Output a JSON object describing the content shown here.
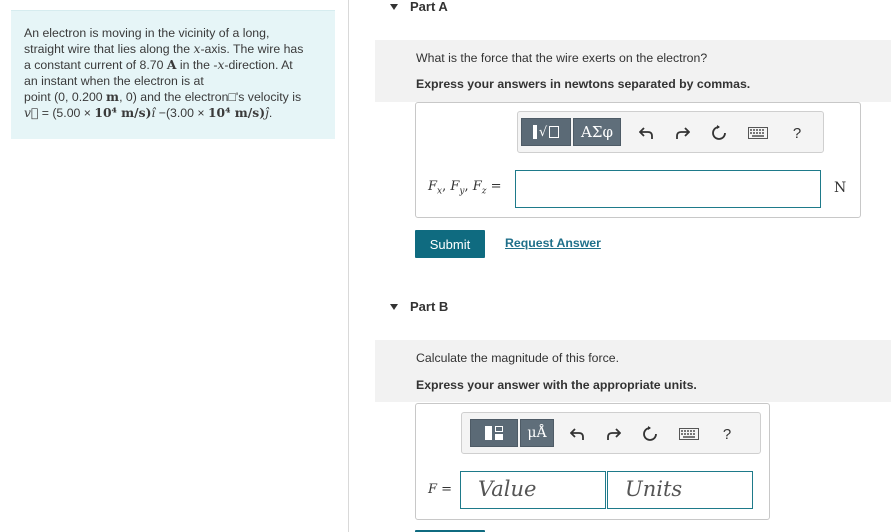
{
  "problem": {
    "lines": [
      "An electron is moving in the vicinity of a long,",
      "straight wire that lies along the ",
      "a constant current of 8.70 ",
      "an instant when the electron is at",
      "point (0, 0.200 ",
      "v"
    ],
    "l1": "An electron is moving in the vicinity of a long,",
    "l2a": "straight wire that lies along the ",
    "l2x": "x",
    "l2b": "-axis. The wire has",
    "l3a": "a constant current of 8.70  ",
    "l3A": "A",
    "l3b": " in the -",
    "l3x": "x",
    "l3c": "-direction. At",
    "l4": "an instant when the electron is at",
    "l5a": "point (0, 0.200 ",
    "l5m": "m",
    "l5b": ", 0) and the electron",
    "l5box": "□",
    "l5c": "'s velocity is",
    "l6v": "v⃗",
    "l6a": " = (5.00 × ",
    "l6p1": "10⁴",
    "l6u1": " m/s)",
    "l6i": "î",
    "l6b": " −(3.00 × ",
    "l6p2": "10⁴",
    "l6u2": " m/s)",
    "l6j": "ĵ",
    "l6end": "."
  },
  "partA": {
    "title": "Part A",
    "question": "What is the force that the wire exerts on the electron?",
    "instruction": "Express your answers in newtons separated by commas.",
    "toolbar": {
      "templates_icon": "template-icon",
      "greek_label": "ΑΣφ",
      "undo_icon": "undo-icon",
      "redo_icon": "redo-icon",
      "reset_icon": "reset-icon",
      "keyboard_icon": "keyboard-icon",
      "help_label": "?"
    },
    "var_label": "Fₓ, F_y, F_z =",
    "fx": "F",
    "unit": "N",
    "input_value": "",
    "submit": "Submit",
    "request": "Request Answer"
  },
  "partB": {
    "title": "Part B",
    "question": "Calculate the magnitude of this force.",
    "instruction": "Express your answer with the appropriate units.",
    "toolbar": {
      "units_label": "μÅ",
      "help_label": "?"
    },
    "var_label": "F =",
    "value_placeholder": "Value",
    "units_placeholder": "Units"
  },
  "colors": {
    "panel_bg": "#e6f5f7",
    "accent": "#0f6b80",
    "link": "#1f6f8a"
  }
}
